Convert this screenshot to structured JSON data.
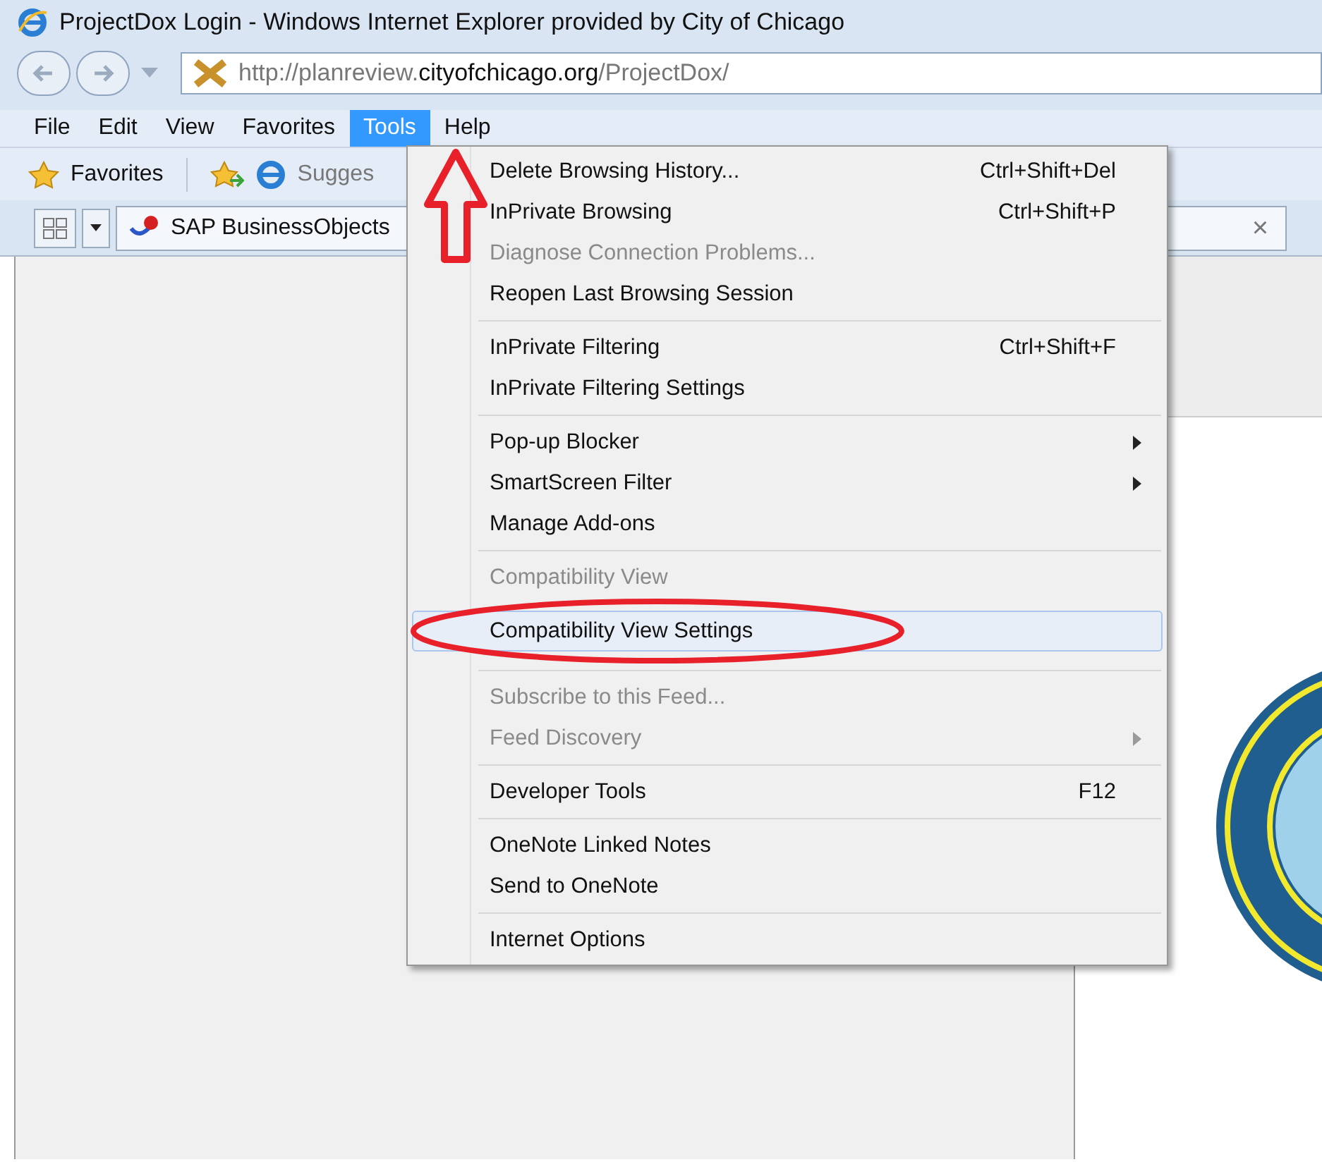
{
  "window": {
    "title": "ProjectDox Login - Windows Internet Explorer provided by City of Chicago"
  },
  "address_bar": {
    "url_prefix": "http://planreview.",
    "url_domain": "cityofchicago.org",
    "url_suffix": "/ProjectDox/"
  },
  "menu_bar": [
    {
      "label": "File",
      "selected": false
    },
    {
      "label": "Edit",
      "selected": false
    },
    {
      "label": "View",
      "selected": false
    },
    {
      "label": "Favorites",
      "selected": false
    },
    {
      "label": "Tools",
      "selected": true
    },
    {
      "label": "Help",
      "selected": false
    }
  ],
  "favorites_bar": {
    "favorites": "Favorites",
    "suggested": "Sugges"
  },
  "tab": {
    "title": "SAP BusinessObjects",
    "close": "×"
  },
  "tools_menu": [
    {
      "kind": "item",
      "label": "Delete Browsing History...",
      "shortcut": "Ctrl+Shift+Del",
      "disabled": false,
      "submenu": false,
      "selected": false
    },
    {
      "kind": "item",
      "label": "InPrivate Browsing",
      "shortcut": "Ctrl+Shift+P",
      "disabled": false,
      "submenu": false,
      "selected": false
    },
    {
      "kind": "item",
      "label": "Diagnose Connection Problems...",
      "disabled": true,
      "submenu": false,
      "selected": false
    },
    {
      "kind": "item",
      "label": "Reopen Last Browsing Session",
      "disabled": false,
      "submenu": false,
      "selected": false
    },
    {
      "kind": "separator"
    },
    {
      "kind": "item",
      "label": "InPrivate Filtering",
      "shortcut": "Ctrl+Shift+F",
      "disabled": false,
      "submenu": false,
      "selected": false
    },
    {
      "kind": "item",
      "label": "InPrivate Filtering Settings",
      "disabled": false,
      "submenu": false,
      "selected": false
    },
    {
      "kind": "separator"
    },
    {
      "kind": "item",
      "label": "Pop-up Blocker",
      "disabled": false,
      "submenu": true,
      "selected": false
    },
    {
      "kind": "item",
      "label": "SmartScreen Filter",
      "disabled": false,
      "submenu": true,
      "selected": false
    },
    {
      "kind": "item",
      "label": "Manage Add-ons",
      "disabled": false,
      "submenu": false,
      "selected": false
    },
    {
      "kind": "separator"
    },
    {
      "kind": "item",
      "label": "Compatibility View",
      "disabled": true,
      "submenu": false,
      "selected": false
    },
    {
      "kind": "item",
      "label": "Compatibility View Settings",
      "disabled": false,
      "submenu": false,
      "selected": true
    },
    {
      "kind": "separator"
    },
    {
      "kind": "item",
      "label": "Subscribe to this Feed...",
      "disabled": true,
      "submenu": false,
      "selected": false
    },
    {
      "kind": "item",
      "label": "Feed Discovery",
      "disabled": true,
      "submenu": true,
      "selected": false
    },
    {
      "kind": "separator"
    },
    {
      "kind": "item",
      "label": "Developer Tools",
      "shortcut": "F12",
      "disabled": false,
      "submenu": false,
      "selected": false
    },
    {
      "kind": "separator"
    },
    {
      "kind": "item",
      "label": "OneNote Linked Notes",
      "disabled": false,
      "submenu": false,
      "selected": false
    },
    {
      "kind": "item",
      "label": "Send to OneNote",
      "disabled": false,
      "submenu": false,
      "selected": false
    },
    {
      "kind": "separator"
    },
    {
      "kind": "item",
      "label": "Internet Options",
      "disabled": false,
      "submenu": false,
      "selected": false
    }
  ]
}
